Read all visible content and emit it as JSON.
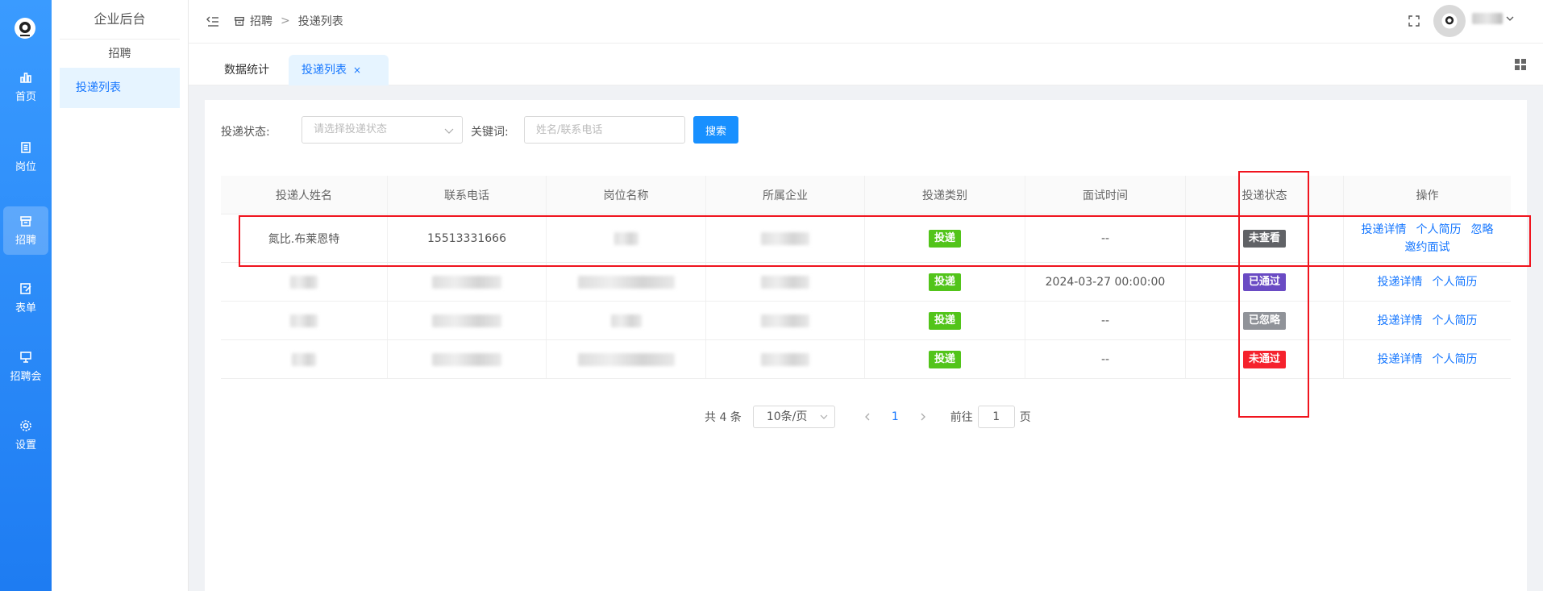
{
  "rail": {
    "items": [
      {
        "label": "首页"
      },
      {
        "label": "岗位"
      },
      {
        "label": "招聘"
      },
      {
        "label": "表单"
      },
      {
        "label": "招聘会"
      },
      {
        "label": "设置"
      }
    ]
  },
  "submenu": {
    "brand": "企业后台",
    "group": "招聘",
    "item": "投递列表"
  },
  "header": {
    "crumb_root": "招聘",
    "crumb_sep": ">",
    "crumb_current": "投递列表"
  },
  "tabs": [
    {
      "label": "数据统计"
    },
    {
      "label": "投递列表"
    }
  ],
  "tab_close": "×",
  "filter": {
    "status_label": "投递状态:",
    "status_placeholder": "请选择投递状态",
    "keyword_label": "关键词:",
    "keyword_placeholder": "姓名/联系电话",
    "search_label": "搜索"
  },
  "table": {
    "headers": [
      "投递人姓名",
      "联系电话",
      "岗位名称",
      "所属企业",
      "投递类别",
      "面试时间",
      "投递状态",
      "操作"
    ],
    "rows": [
      {
        "name": "氮比.布莱恩特",
        "phone": "15513331666",
        "type": "投递",
        "time": "--",
        "status": "未查看",
        "actions": [
          "投递详情",
          "个人简历",
          "忽略",
          "邀约面试"
        ]
      },
      {
        "name": "",
        "phone": "",
        "type": "投递",
        "time": "2024-03-27 00:00:00",
        "status": "已通过",
        "actions": [
          "投递详情",
          "个人简历"
        ]
      },
      {
        "name": "",
        "phone": "",
        "type": "投递",
        "time": "--",
        "status": "已忽略",
        "actions": [
          "投递详情",
          "个人简历"
        ]
      },
      {
        "name": "",
        "phone": "",
        "type": "投递",
        "time": "--",
        "status": "未通过",
        "actions": [
          "投递详情",
          "个人简历"
        ]
      }
    ]
  },
  "pager": {
    "total": "共 4 条",
    "size": "10条/页",
    "current": "1",
    "goto_prefix": "前往",
    "goto_value": "1",
    "goto_suffix": "页"
  },
  "colors": {
    "rail": "#1e7cf2",
    "accent": "#1677ff",
    "type_tag": "#52c41a",
    "status_unread": "#606266",
    "status_passed": "#6a4bc4",
    "status_ignored": "#909399",
    "status_failed": "#f5222d",
    "annotation": "#f0141e"
  }
}
